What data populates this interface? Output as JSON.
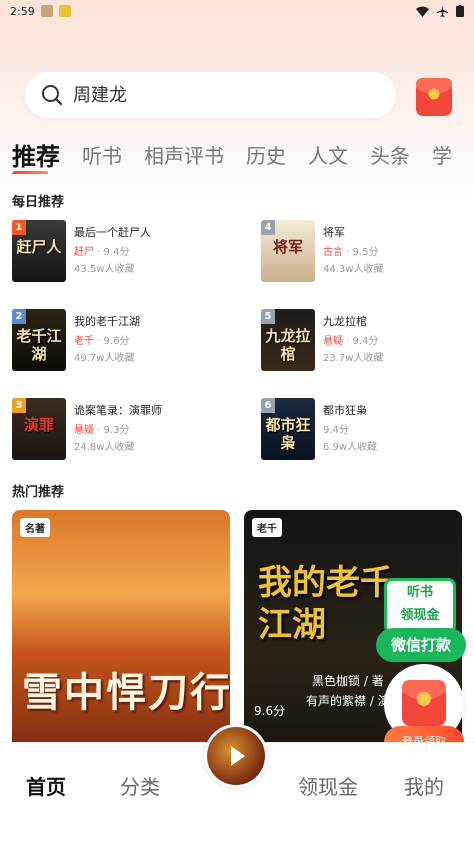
{
  "status_bar": {
    "time": "2:59"
  },
  "search": {
    "placeholder": "周建龙"
  },
  "tabs": [
    "推荐",
    "听书",
    "相声评书",
    "历史",
    "人文",
    "头条",
    "学"
  ],
  "daily": {
    "title": "每日推荐",
    "books": [
      {
        "rank": "1",
        "title": "最后一个赶尸人",
        "tag": "赶尸",
        "score": "9.4分",
        "fav": "43.5w人收藏",
        "cover_text": "赶尸人",
        "rank_color": "#f05a28"
      },
      {
        "rank": "4",
        "title": "将军",
        "tag": "古言",
        "score": "9.5分",
        "fav": "44.3w人收藏",
        "cover_text": "将军",
        "rank_color": "#9aa3ad"
      },
      {
        "rank": "2",
        "title": "我的老千江湖",
        "tag": "老千",
        "score": "9.6分",
        "fav": "49.7w人收藏",
        "cover_text": "老千江湖",
        "rank_color": "#5b8bd8"
      },
      {
        "rank": "5",
        "title": "九龙拉棺",
        "tag": "悬疑",
        "score": "9.4分",
        "fav": "23.7w人收藏",
        "cover_text": "九龙拉棺",
        "rank_color": "#9aa3ad"
      },
      {
        "rank": "3",
        "title": "诡案笔录：演罪师",
        "tag": "悬疑",
        "score": "9.3分",
        "fav": "24.8w人收藏",
        "cover_text": "演罪",
        "rank_color": "#f0a020"
      },
      {
        "rank": "6",
        "title": "都市狂枭",
        "tag": "",
        "score": "9.4分",
        "fav": "6.9w人收藏",
        "cover_text": "都市狂枭",
        "rank_color": "#9aa3ad"
      }
    ]
  },
  "hot": {
    "title": "热门推荐",
    "cards": [
      {
        "badge": "名著",
        "cover_text": "雪中悍刀行",
        "score": ""
      },
      {
        "badge": "老千",
        "cover_text": "我的老千江湖",
        "score": "9.6分",
        "author": "黑色枷锁 / 著",
        "sub": "有声的紫襟 / 演"
      }
    ]
  },
  "floating": {
    "listen_line1": "听书",
    "listen_line2": "领现金",
    "wechat": "微信打款",
    "login": "登录领取"
  },
  "bottom_nav": [
    "首页",
    "分类",
    "领现金",
    "我的"
  ],
  "colors": {
    "accent": "#f04a3a",
    "green": "#1bb55a"
  }
}
